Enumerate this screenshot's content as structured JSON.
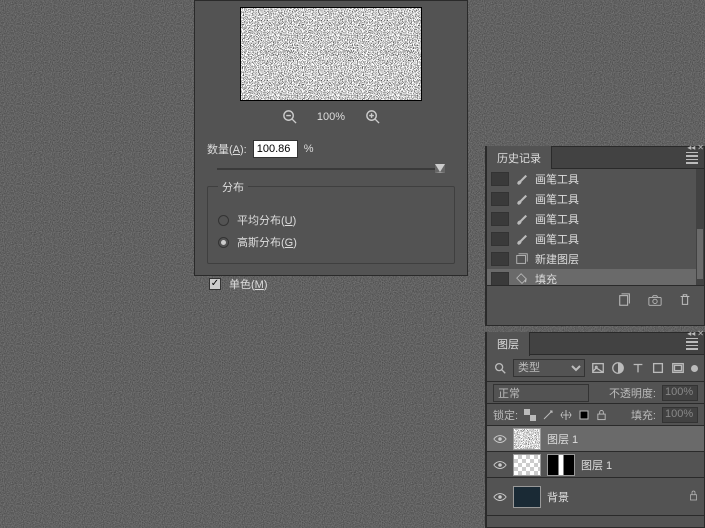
{
  "dialog": {
    "zoom_level": "100%",
    "amount_label_pre": "数量(",
    "amount_hot": "A",
    "amount_label_post": "):",
    "amount_value": "100.86",
    "amount_unit": "%",
    "dist_legend": "分布",
    "dist_uniform_pre": "平均分布(",
    "dist_uniform_hot": "U",
    "dist_uniform_post": ")",
    "dist_gauss_pre": "高斯分布(",
    "dist_gauss_hot": "G",
    "dist_gauss_post": ")",
    "mono_pre": "单色(",
    "mono_hot": "M",
    "mono_post": ")"
  },
  "history": {
    "title": "历史记录",
    "items": [
      {
        "icon": "brush",
        "label": "画笔工具"
      },
      {
        "icon": "brush",
        "label": "画笔工具"
      },
      {
        "icon": "brush",
        "label": "画笔工具"
      },
      {
        "icon": "brush",
        "label": "画笔工具"
      },
      {
        "icon": "newlayer",
        "label": "新建图层"
      },
      {
        "icon": "fill",
        "label": "填充",
        "sel": true
      }
    ]
  },
  "layers": {
    "title": "图层",
    "type_label": "类型",
    "blend_mode": "正常",
    "opacity_label": "不透明度:",
    "opacity_value": "100%",
    "lock_label": "锁定:",
    "fill_label": "填充:",
    "fill_value": "100%",
    "items": [
      {
        "name": "图层 1",
        "thumb": "noise",
        "sel": true
      },
      {
        "name": "图层 1",
        "thumb": "checker",
        "mask": true
      },
      {
        "name": "背景",
        "thumb": "dark",
        "locked": true,
        "bg": true
      }
    ]
  }
}
